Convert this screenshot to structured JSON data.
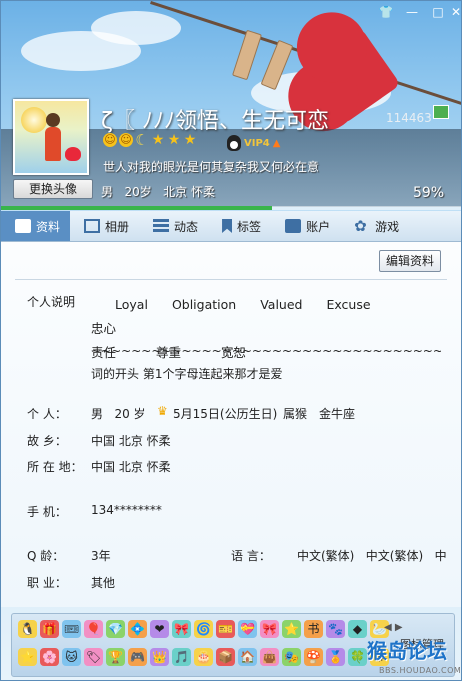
{
  "window": {
    "controls": [
      "skin",
      "minimize",
      "maximize",
      "close"
    ]
  },
  "header": {
    "change_avatar_label": "更换头像",
    "nickname": "ζ〖 ﾉﾉﾉ领悟、生无可恋",
    "qq_number": "114463",
    "signature": "世人对我的眼光是何其复杂我又何必在意",
    "basic_info": "男   20岁   北京 怀柔",
    "completion_percent": 59,
    "completion_text": "59%",
    "vip_label": "VIP4",
    "level_icons": [
      "sun",
      "sun",
      "moon",
      "star",
      "star",
      "star"
    ]
  },
  "tabs": [
    {
      "label": "资料",
      "icon": "profile-card-icon",
      "active": true
    },
    {
      "label": "相册",
      "icon": "album-icon",
      "active": false
    },
    {
      "label": "动态",
      "icon": "feed-icon",
      "active": false
    },
    {
      "label": "标签",
      "icon": "tag-icon",
      "active": false
    },
    {
      "label": "账户",
      "icon": "account-icon",
      "active": false
    },
    {
      "label": "游戏",
      "icon": "game-icon",
      "active": false
    }
  ],
  "edit_button_label": "编辑资料",
  "profile": {
    "bio_label": "个人说明",
    "bio_words": [
      "Loyal",
      "Obligation",
      "Valued",
      "Excuse",
      "忠心",
      "责任",
      "尊重",
      "宽恕"
    ],
    "bio_line1": "~~~~~~~~~~~~~~~~~~~~~~~~~~~~~~~~~~~«□»把每个英文单",
    "bio_line2": "词的开头 第1个字母连起来那才是爱",
    "person_label": "个    人：",
    "person_gender_age": "男   20 岁",
    "birthday": "5月15日(公历生日)",
    "zodiac": "属猴",
    "constellation": "金牛座",
    "hometown_label": "故    乡：",
    "hometown": "中国 北京 怀柔",
    "location_label": "所 在 地：",
    "location": "中国 北京 怀柔",
    "phone_label": "手    机：",
    "phone": "134********",
    "qage_label": "Q    龄：",
    "qage": "3年",
    "language_label": "语    言：",
    "language": "中文(繁体)   中文(繁体)   中",
    "job_label": "职    业：",
    "job": "其他"
  },
  "iconbar": {
    "manage_label": "图标管理",
    "row1": [
      "🐧",
      "🎁",
      "🎟",
      "🎈",
      "💎",
      "💠",
      "❤",
      "🎀",
      "🌀",
      "🎫",
      "💝",
      "🎀",
      "⭐",
      "书",
      "🐾",
      "◆",
      "🦢"
    ],
    "row2": [
      "⭐",
      "🌸",
      "🐱",
      "🏷",
      "🏆",
      "🎮",
      "👑",
      "🎵",
      "🎂",
      "📦",
      "🏠",
      "👜",
      "🎭",
      "🍄",
      "🏅",
      "🍀",
      "⚙"
    ]
  },
  "watermark": {
    "text": "猴岛论坛",
    "url": "BBS.HOUDAO.COM"
  },
  "colors": {
    "accent": "#5a8fc4",
    "progress": "#39b54a",
    "heart": "#d8323d"
  }
}
